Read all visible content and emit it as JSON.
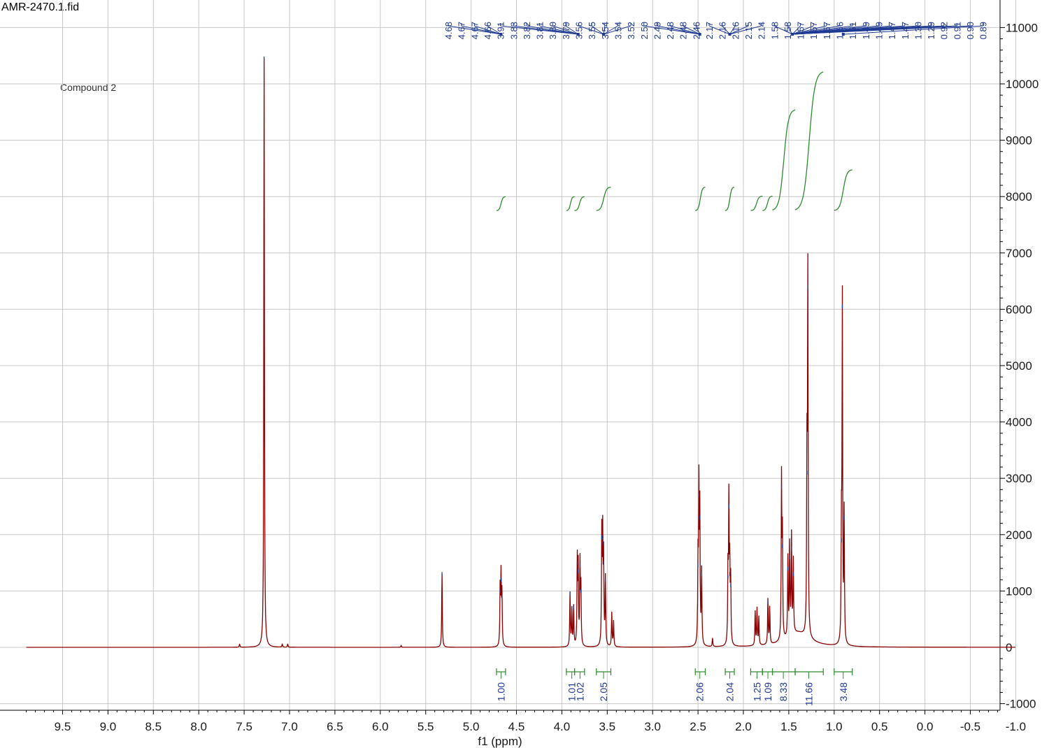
{
  "file_name": "AMR-2470.1.fid",
  "compound_label": "Compound 2",
  "colors": {
    "spectrum": "#8b0000",
    "integral": "#2e8b2e",
    "peak_label": "#1f3a93",
    "grid": "#c8c8c8",
    "axis": "#000000"
  },
  "chart_data": {
    "type": "line",
    "title": "",
    "xlabel": "f1 (ppm)",
    "ylabel": "",
    "xlim": [
      9.9,
      -1.0
    ],
    "ylim": [
      -1100,
      11200
    ],
    "x_reversed": true,
    "x_ticks": [
      "9.5",
      "9.0",
      "8.5",
      "8.0",
      "7.5",
      "7.0",
      "6.5",
      "6.0",
      "5.5",
      "5.0",
      "4.5",
      "4.0",
      "3.5",
      "3.0",
      "2.5",
      "2.0",
      "1.5",
      "1.0",
      "0.5",
      "0.0",
      "-0.5",
      "-1.0"
    ],
    "y_ticks": [
      "-1000",
      "0",
      "1000",
      "2000",
      "3000",
      "4000",
      "5000",
      "6000",
      "7000",
      "8000",
      "9000",
      "10000",
      "11000"
    ],
    "grid": true,
    "peaks": [
      {
        "ppm": 7.55,
        "height": 60
      },
      {
        "ppm": 7.28,
        "height": 10450
      },
      {
        "ppm": 7.08,
        "height": 60
      },
      {
        "ppm": 7.02,
        "height": 60
      },
      {
        "ppm": 5.77,
        "height": 30
      },
      {
        "ppm": 5.32,
        "height": 1300
      },
      {
        "ppm": 4.68,
        "height": 1000
      },
      {
        "ppm": 4.67,
        "height": 1200
      },
      {
        "ppm": 4.66,
        "height": 900
      },
      {
        "ppm": 3.91,
        "height": 950
      },
      {
        "ppm": 3.89,
        "height": 650
      },
      {
        "ppm": 3.87,
        "height": 700
      },
      {
        "ppm": 3.83,
        "height": 1500
      },
      {
        "ppm": 3.82,
        "height": 1350
      },
      {
        "ppm": 3.8,
        "height": 1450
      },
      {
        "ppm": 3.79,
        "height": 1000
      },
      {
        "ppm": 3.56,
        "height": 1950
      },
      {
        "ppm": 3.55,
        "height": 1850
      },
      {
        "ppm": 3.54,
        "height": 1500
      },
      {
        "ppm": 3.52,
        "height": 1200
      },
      {
        "ppm": 3.45,
        "height": 600
      },
      {
        "ppm": 3.43,
        "height": 450
      },
      {
        "ppm": 2.5,
        "height": 1450
      },
      {
        "ppm": 2.49,
        "height": 2700
      },
      {
        "ppm": 2.48,
        "height": 2300
      },
      {
        "ppm": 2.46,
        "height": 1300
      },
      {
        "ppm": 2.34,
        "height": 150
      },
      {
        "ppm": 2.17,
        "height": 1250
      },
      {
        "ppm": 2.16,
        "height": 2500
      },
      {
        "ppm": 2.15,
        "height": 1300
      },
      {
        "ppm": 2.14,
        "height": 1100
      },
      {
        "ppm": 1.87,
        "height": 600
      },
      {
        "ppm": 1.85,
        "height": 650
      },
      {
        "ppm": 1.83,
        "height": 500
      },
      {
        "ppm": 1.73,
        "height": 800
      },
      {
        "ppm": 1.71,
        "height": 650
      },
      {
        "ppm": 1.58,
        "height": 2850
      },
      {
        "ppm": 1.57,
        "height": 1800
      },
      {
        "ppm": 1.51,
        "height": 1400
      },
      {
        "ppm": 1.49,
        "height": 1600
      },
      {
        "ppm": 1.47,
        "height": 1750
      },
      {
        "ppm": 1.45,
        "height": 1300
      },
      {
        "ppm": 1.3,
        "height": 3100
      },
      {
        "ppm": 1.29,
        "height": 6400
      },
      {
        "ppm": 0.92,
        "height": 1900
      },
      {
        "ppm": 0.91,
        "height": 6050
      },
      {
        "ppm": 0.89,
        "height": 2300
      }
    ],
    "peak_labels": [
      "4.68",
      "4.67",
      "4.67",
      "4.66",
      "3.91",
      "3.83",
      "3.82",
      "3.81",
      "3.80",
      "3.79",
      "3.56",
      "3.55",
      "3.54",
      "3.54",
      "3.52",
      "2.50",
      "2.49",
      "2.48",
      "2.48",
      "2.46",
      "2.17",
      "2.16",
      "2.16",
      "2.15",
      "2.14",
      "1.58",
      "1.58",
      "1.57",
      "1.57",
      "1.57",
      "1.56",
      "1.51",
      "1.49",
      "1.49",
      "1.47",
      "1.47",
      "1.30",
      "1.29",
      "0.92",
      "0.91",
      "0.90",
      "0.89"
    ],
    "peak_label_groups": [
      {
        "labels": [
          0,
          3
        ],
        "ppm": 4.67
      },
      {
        "labels": [
          4,
          9
        ],
        "ppm": 3.82
      },
      {
        "labels": [
          10,
          14
        ],
        "ppm": 3.54
      },
      {
        "labels": [
          15,
          19
        ],
        "ppm": 2.48
      },
      {
        "labels": [
          20,
          24
        ],
        "ppm": 2.15
      },
      {
        "labels": [
          25,
          40
        ],
        "ppm": 1.46
      },
      {
        "labels": [
          41,
          41
        ],
        "ppm": 0.9
      }
    ],
    "integrals": [
      {
        "label": "1.00",
        "from": 4.72,
        "to": 4.62,
        "label_ppm": 4.67
      },
      {
        "label": "1.01",
        "from": 3.95,
        "to": 3.86,
        "label_ppm": 3.89
      },
      {
        "label": "1.02",
        "from": 3.86,
        "to": 3.75,
        "label_ppm": 3.8
      },
      {
        "label": "2.05",
        "from": 3.62,
        "to": 3.46,
        "label_ppm": 3.54
      },
      {
        "label": "2.06",
        "from": 2.53,
        "to": 2.42,
        "label_ppm": 2.48
      },
      {
        "label": "2.04",
        "from": 2.2,
        "to": 2.1,
        "label_ppm": 2.15
      },
      {
        "label": "1.25",
        "from": 1.92,
        "to": 1.79,
        "label_ppm": 1.85
      },
      {
        "label": "1.09",
        "from": 1.79,
        "to": 1.68,
        "label_ppm": 1.73
      },
      {
        "label": "8.33",
        "from": 1.68,
        "to": 1.43,
        "label_ppm": 1.56
      },
      {
        "label": "11.66",
        "from": 1.43,
        "to": 1.12,
        "label_ppm": 1.28
      },
      {
        "label": "3.48",
        "from": 1.0,
        "to": 0.8,
        "label_ppm": 0.9
      }
    ]
  }
}
